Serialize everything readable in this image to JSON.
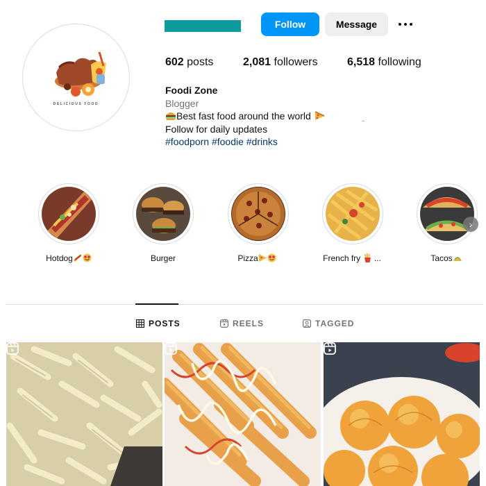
{
  "profile": {
    "follow_label": "Follow",
    "message_label": "Message",
    "avatar_caption": "DELICIOUS FOOD",
    "stats": {
      "posts_count": "602",
      "posts_label": "posts",
      "followers_count": "2,081",
      "followers_label": "followers",
      "following_count": "6,518",
      "following_label": "following"
    },
    "bio": {
      "name": "Foodi Zone",
      "category": "Blogger",
      "line1": "Best fast food around the world",
      "line2": "Follow for daily updates",
      "hashtags": "#foodporn #foodie #drinks"
    },
    "username_bar_color": "#0e9ba0"
  },
  "highlights": [
    {
      "label": "Hotdog",
      "emoji": [
        "hotdog",
        "heart-eyes"
      ]
    },
    {
      "label": "Burger",
      "emoji": []
    },
    {
      "label": "Pizza",
      "emoji": [
        "pizza",
        "heart-eyes"
      ]
    },
    {
      "label": "French fry",
      "emoji": [
        "fries"
      ],
      "suffix": "..."
    },
    {
      "label": "Tacos",
      "emoji": [
        "taco"
      ]
    }
  ],
  "tabs": [
    {
      "label": "POSTS",
      "icon": "grid-icon",
      "active": true
    },
    {
      "label": "REELS",
      "icon": "reels-icon",
      "active": false
    },
    {
      "label": "TAGGED",
      "icon": "tagged-icon",
      "active": false
    }
  ],
  "posts": [
    {
      "subject": "creamy pasta",
      "reel": true
    },
    {
      "subject": "fries with sauce",
      "reel": true
    },
    {
      "subject": "fried balls",
      "reel": true
    }
  ],
  "colors": {
    "follow_button": "#0095f6",
    "message_button": "#efefef",
    "hashtag": "#00376b",
    "muted_text": "#737373"
  }
}
